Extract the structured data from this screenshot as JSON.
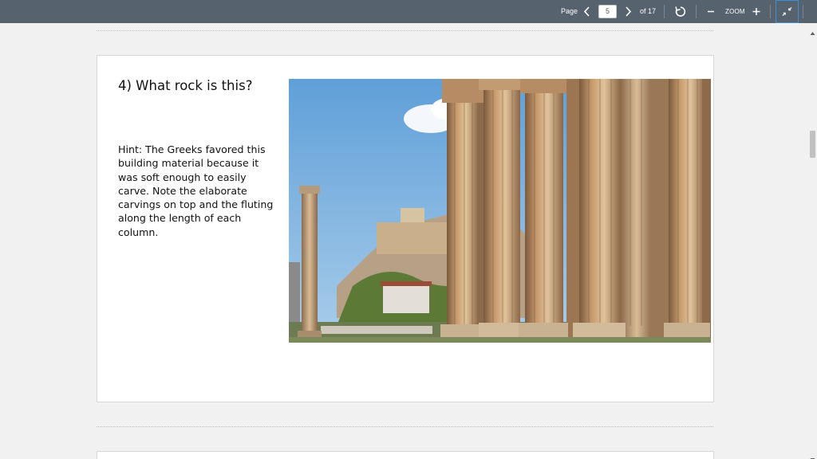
{
  "toolbar": {
    "page_label": "Page",
    "page_value": "5",
    "page_total": "of 17",
    "zoom_label": "ZOOM",
    "icons": [
      "chevron-left-icon",
      "chevron-right-icon",
      "rotate-icon",
      "minus-icon",
      "plus-icon",
      "collapse-icon"
    ]
  },
  "slide": {
    "title": "4) What rock is this?",
    "hint": "Hint: The Greeks favored this\nbuilding material because it\nwas soft enough to easily\ncarve.  Note the elaborate\ncarvings on top and the fluting\nalong the length of each\ncolumn."
  },
  "colors": {
    "toolbar_bg": "#56636f",
    "focus_border": "#3f8fd8",
    "viewer_bg": "#f1f1f1"
  }
}
